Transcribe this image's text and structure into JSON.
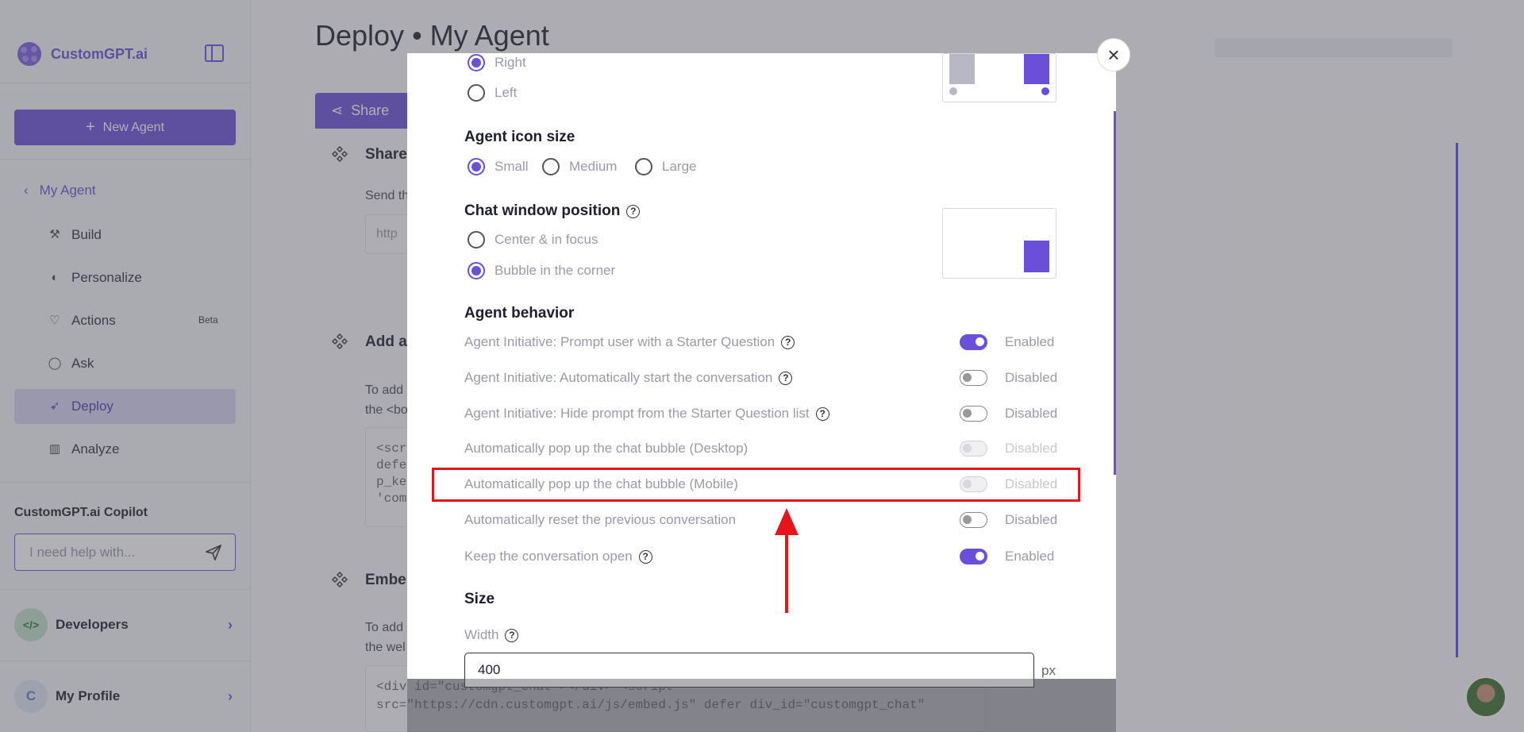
{
  "app": {
    "logo_text": "CustomGPT.ai"
  },
  "sidebar": {
    "new_agent_label": "New Agent",
    "back_label": "My Agent",
    "items": [
      {
        "label": "Build",
        "icon": "build-icon"
      },
      {
        "label": "Personalize",
        "icon": "palette-icon"
      },
      {
        "label": "Actions",
        "icon": "heart-icon",
        "badge": "Beta"
      },
      {
        "label": "Ask",
        "icon": "chat-icon"
      },
      {
        "label": "Deploy",
        "icon": "rocket-icon",
        "active": true
      },
      {
        "label": "Analyze",
        "icon": "chart-icon"
      }
    ],
    "copilot_title": "CustomGPT.ai Copilot",
    "copilot_placeholder": "I need help with...",
    "developers_label": "Developers",
    "developers_avatar": "</>",
    "profile_label": "My Profile",
    "profile_initial": "C"
  },
  "page": {
    "title": "Deploy • My Agent",
    "share_tab_label": "Share",
    "section1_head": "Share",
    "section1_text": "Send th",
    "section1_field": "http",
    "section2_head": "Add a",
    "section2_text_1": "To add",
    "section2_text_2": "the <bo",
    "section2_code": "<scri\ndefe\np_ke\n'com",
    "section3_head": "Embe",
    "section3_text_1": "To add",
    "section3_text_2": "the wel",
    "section3_code": "<div id=\"customgpt_chat\"></div> <script\nsrc=\"https://cdn.customgpt.ai/js/embed.js\" defer div_id=\"customgpt_chat\""
  },
  "modal": {
    "position_options": [
      {
        "label": "Right",
        "selected": true
      },
      {
        "label": "Left",
        "selected": false
      }
    ],
    "icon_size_title": "Agent icon size",
    "icon_size_options": [
      {
        "label": "Small",
        "selected": true
      },
      {
        "label": "Medium",
        "selected": false
      },
      {
        "label": "Large",
        "selected": false
      }
    ],
    "chat_window_title": "Chat window position",
    "chat_window_options": [
      {
        "label": "Center & in focus",
        "selected": false
      },
      {
        "label": "Bubble in the corner",
        "selected": true
      }
    ],
    "behavior_title": "Agent behavior",
    "behaviors": [
      {
        "label": "Agent Initiative: Prompt user with a Starter Question",
        "help": true,
        "state": "Enabled"
      },
      {
        "label": "Agent Initiative: Automatically start the conversation",
        "help": true,
        "state": "Disabled"
      },
      {
        "label": "Agent Initiative: Hide prompt from the Starter Question list",
        "help": true,
        "state": "Disabled"
      },
      {
        "label": "Automatically pop up the chat bubble (Desktop)",
        "help": false,
        "state": "Disabled"
      },
      {
        "label": "Automatically pop up the chat bubble (Mobile)",
        "help": false,
        "state": "Disabled"
      },
      {
        "label": "Automatically reset the previous conversation",
        "help": false,
        "state": "Disabled"
      },
      {
        "label": "Keep the conversation open",
        "help": true,
        "state": "Enabled"
      }
    ],
    "size_title": "Size",
    "width_label": "Width",
    "width_value": "400",
    "width_unit": "px"
  },
  "colors": {
    "accent": "#6b4fd8",
    "annotation": "#e8141c"
  }
}
